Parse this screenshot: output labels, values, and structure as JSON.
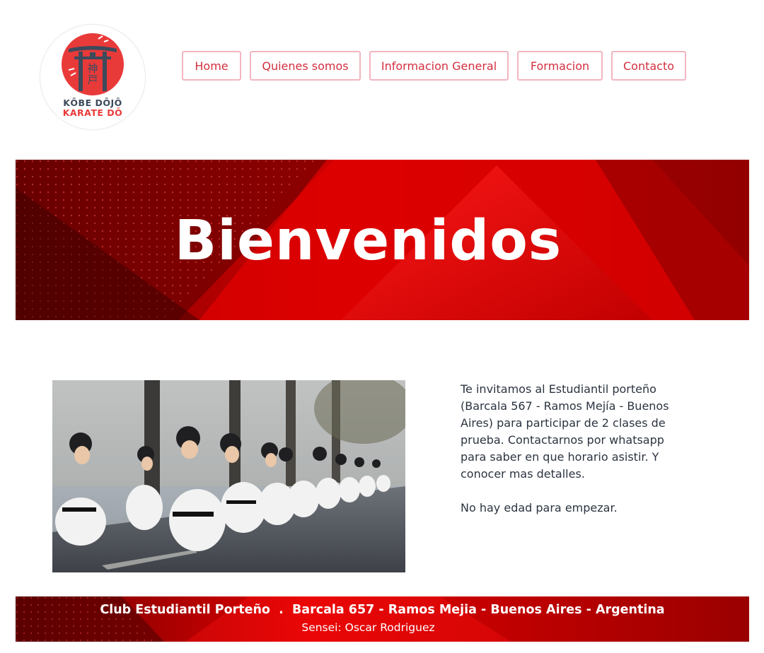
{
  "logo": {
    "line1": "KŌBE DŌJŌ",
    "line2": "KARATE DŌ",
    "kanji": "神戸",
    "colors": {
      "red": "#e93a3a",
      "slate": "#3d4a5c"
    }
  },
  "nav": {
    "items": [
      {
        "label": "Home"
      },
      {
        "label": "Quienes somos"
      },
      {
        "label": "Informacion General"
      },
      {
        "label": "Formacion"
      },
      {
        "label": "Contacto"
      }
    ],
    "border_color": "#f2b5be",
    "text_color": "#d22f3f"
  },
  "hero": {
    "title": "Bienvenidos",
    "colors": {
      "dark": "#6e0000",
      "mid": "#c40000",
      "bright": "#f00000"
    }
  },
  "intro": {
    "paragraph1": "Te invitamos al Estudiantil porteño (Barcala 567 - Ramos Mejía - Buenos Aires) para participar de 2 clases de prueba.  Contactarnos por whatsapp para saber en que horario asistir. Y conocer mas detalles.",
    "paragraph2": "No hay edad para empezar."
  },
  "footer": {
    "address": "Club Estudiantil Porteño  .  Barcala 657 - Ramos Mejia - Buenos Aires - Argentina",
    "sensei": "Sensei: Oscar Rodriguez"
  }
}
